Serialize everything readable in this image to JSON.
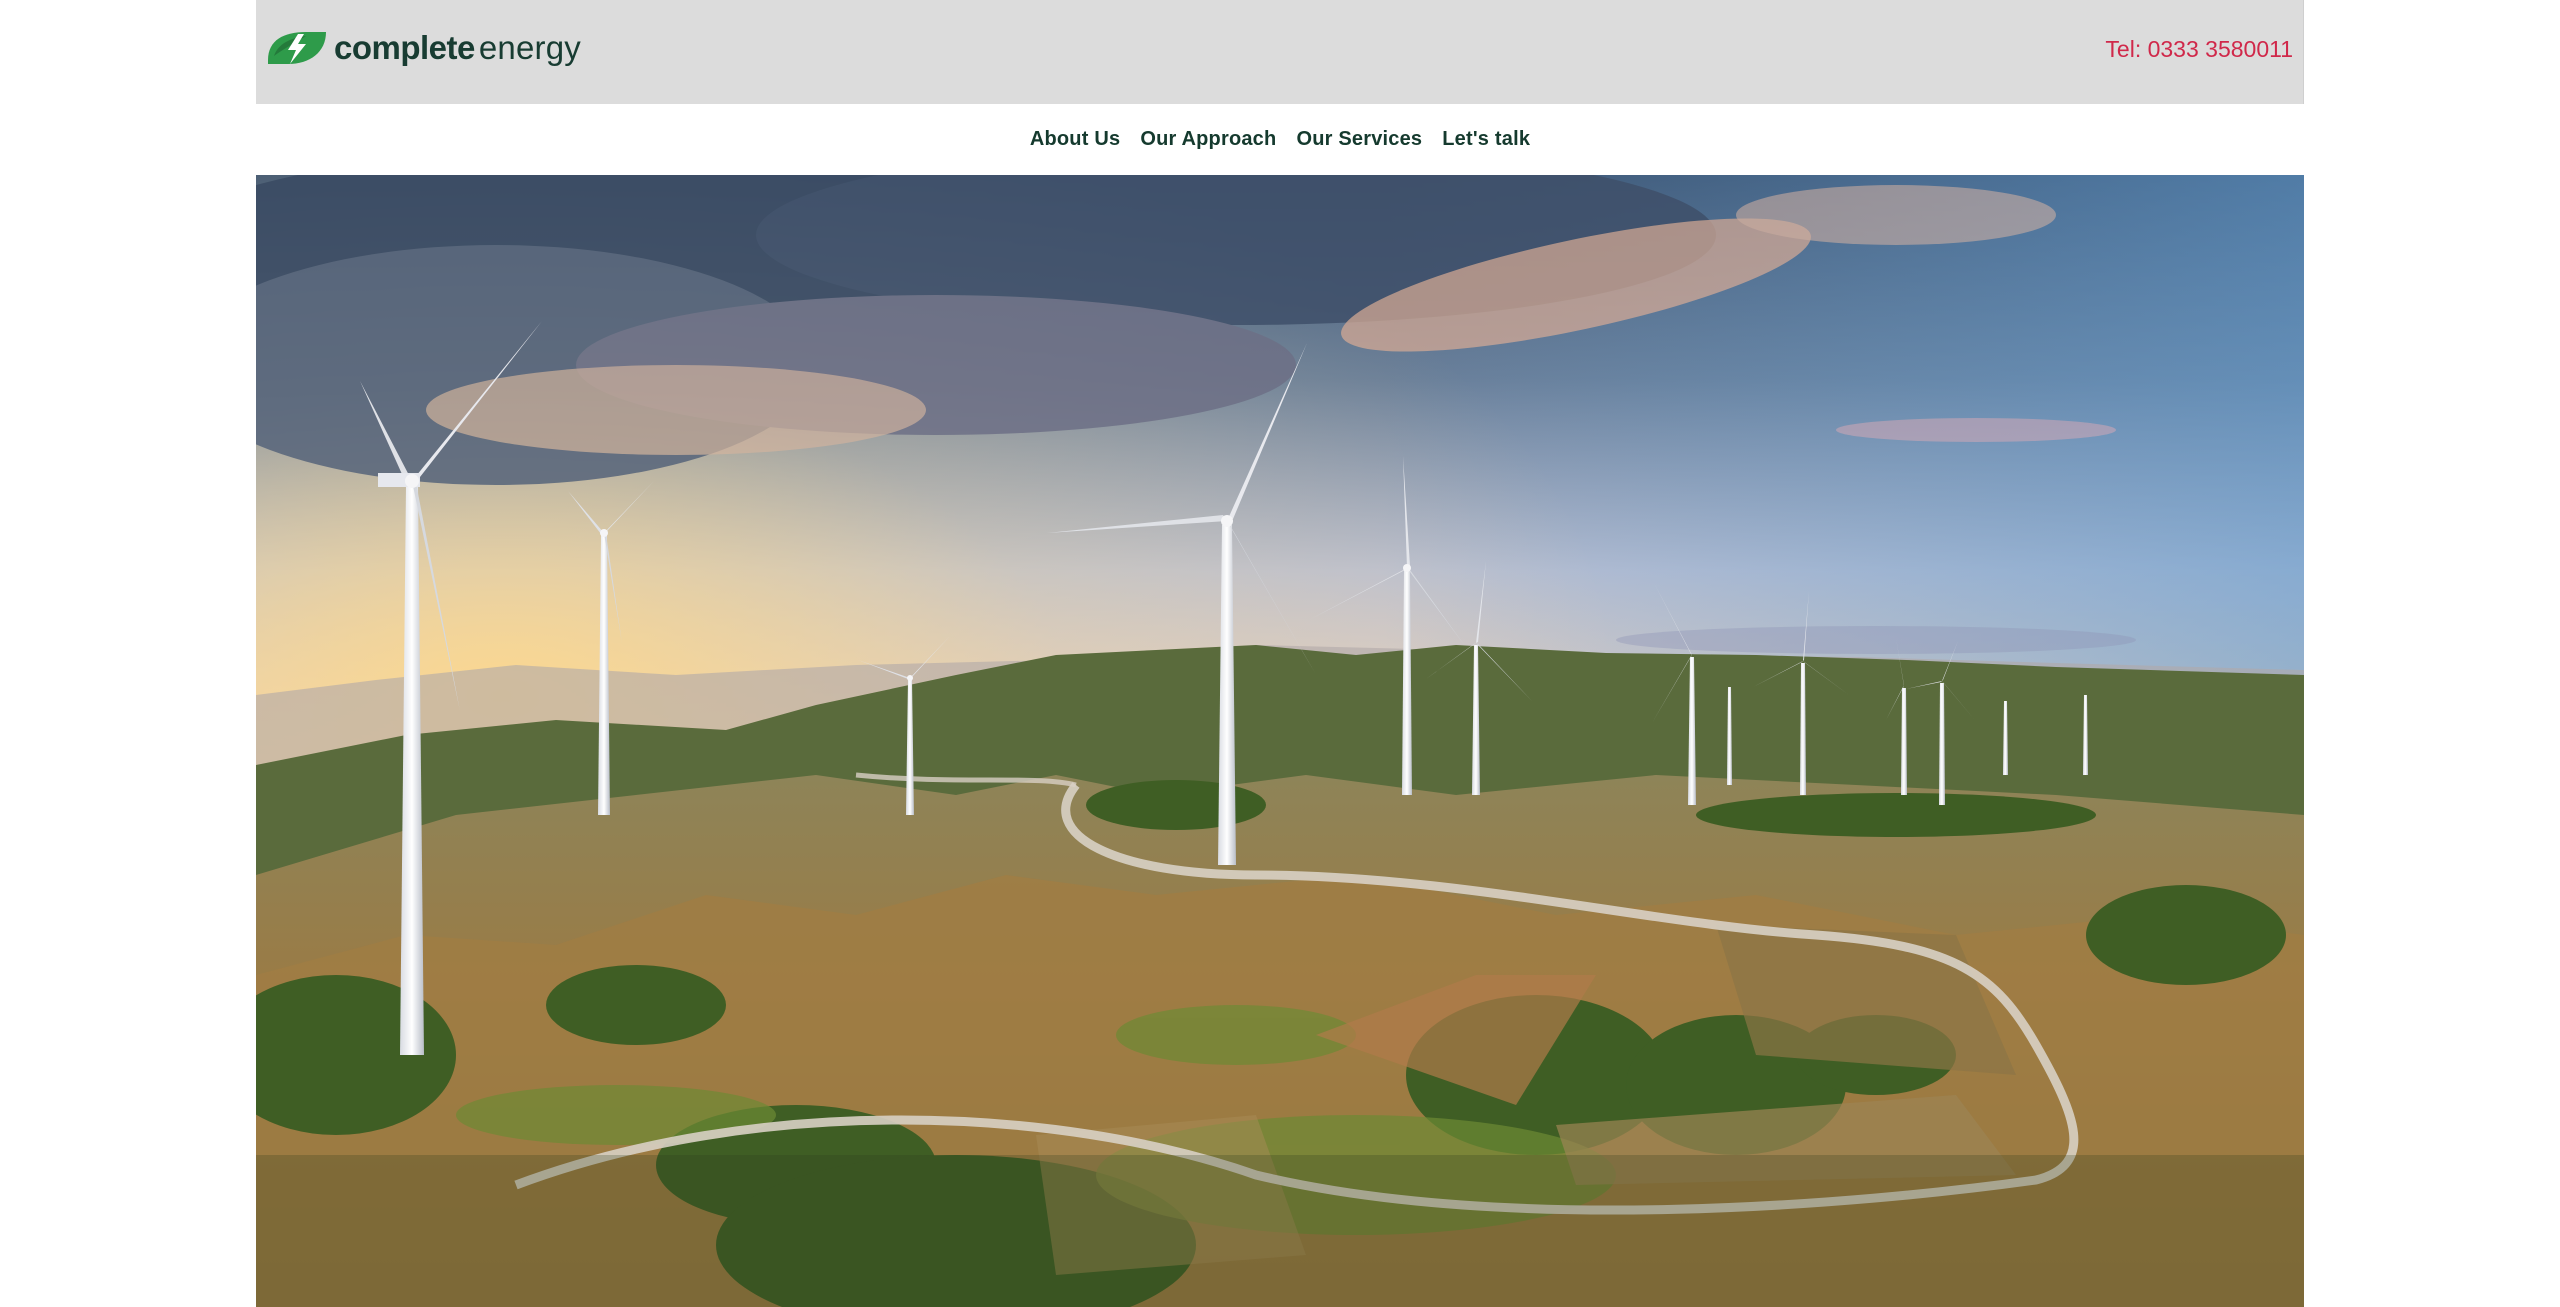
{
  "header": {
    "logo": {
      "bold": "complete",
      "light": "energy",
      "mark": "leaf-bolt-logo-icon",
      "colors": {
        "leaf": "#2e9b4a",
        "bolt": "#ffffff",
        "text": "#183c32"
      }
    },
    "phone": "Tel: 0333 3580011",
    "phone_color": "#d0284a",
    "background": "#dcdcdc"
  },
  "nav": {
    "items": [
      {
        "label": "About Us"
      },
      {
        "label": "Our Approach"
      },
      {
        "label": "Our Services"
      },
      {
        "label": "Let's talk"
      }
    ]
  },
  "hero": {
    "image": "wind-turbines-landscape-photo",
    "colors": {
      "sky_top": "#4d6684",
      "sky_mid": "#c7cad9",
      "horizon": "#f3d3a0",
      "hills": "#8a7a44",
      "trees": "#4c6a2c",
      "turbine": "#f2f2f2"
    }
  }
}
